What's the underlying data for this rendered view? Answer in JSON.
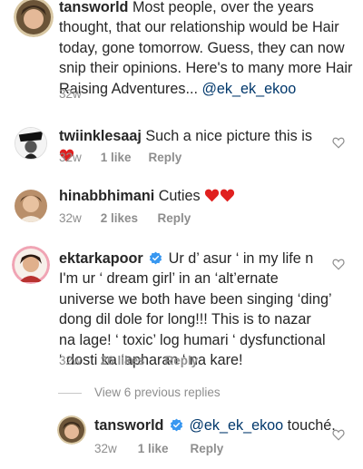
{
  "caption": {
    "username": "tansworld",
    "text": "Most people, over the years thought, that our relationship would be Hair today, gone tomorrow. Guess, they can now snip their opinions.  Here's to many more Hair Raising Adventures... ",
    "mention": "@ek_ek_ekoo",
    "time": "32w"
  },
  "comments": [
    {
      "username": "twiinklesaaj",
      "text": "Such a nice picture this is",
      "time": "32w",
      "likes": "1 like",
      "reply": "Reply"
    },
    {
      "username": "hinabbhimani",
      "text": "Cuties",
      "time": "32w",
      "likes": "2 likes",
      "reply": "Reply"
    },
    {
      "username": "ektarkapoor",
      "text": "Ur d’ asur ‘ in my life n I'm ur ‘ dream girl’ in an ‘alt’ernate universe we both have been singing ‘ding’ dong dil dole for long!!! This is to nazar na lage! ‘ toxic’ log humari ‘ dysfunctional ‘ dosti ka ‘apharan ‘ na kare!",
      "time": "32w",
      "likes": "26 likes",
      "reply": "Reply"
    }
  ],
  "view_replies": "View 6 previous replies",
  "reply": {
    "username": "tansworld",
    "mention": "@ek_ek_ekoo",
    "text": " touché.",
    "time": "32w",
    "likes": "1 like",
    "reply": "Reply"
  },
  "colors": {
    "heart": "#e0201f",
    "verified": "#3897f0",
    "meta": "#8e8e8e",
    "mention": "#00376b"
  },
  "icons": {
    "like": "heart-outline-icon",
    "verified": "verified-badge-icon",
    "emoji": "red-heart-emoji"
  }
}
